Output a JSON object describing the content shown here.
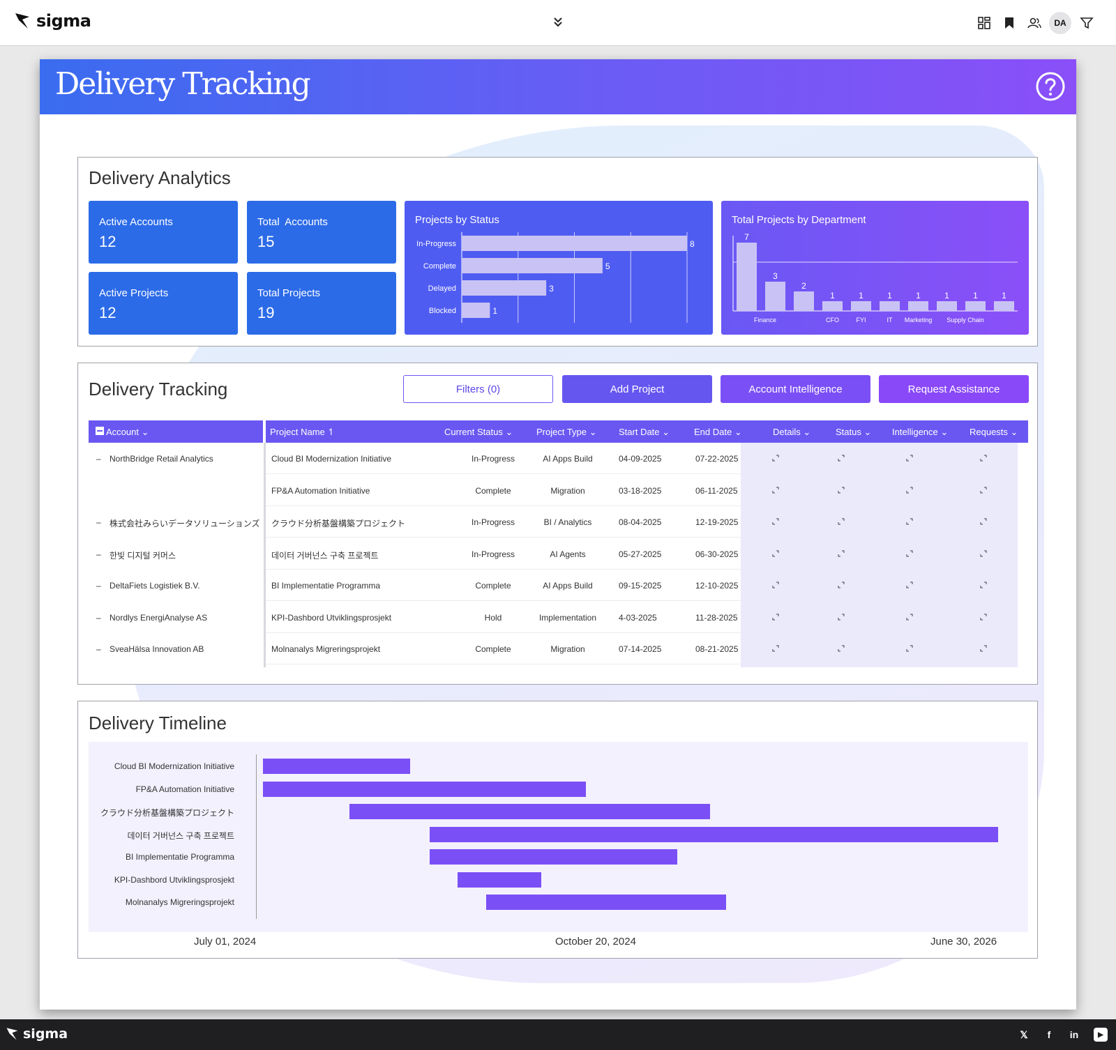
{
  "app": {
    "logo_text": "sigma",
    "avatar_initials": "DA"
  },
  "page": {
    "title": "Delivery Tracking"
  },
  "analytics": {
    "title": "Delivery Analytics",
    "kpis": [
      {
        "label": "Active Accounts",
        "value": "12"
      },
      {
        "label": "Total  Accounts",
        "value": "15"
      },
      {
        "label": "Active Projects",
        "value": "12"
      },
      {
        "label": "Total Projects",
        "value": "19"
      }
    ]
  },
  "chart_data": [
    {
      "type": "bar",
      "orientation": "horizontal",
      "title": "Projects by Status",
      "categories": [
        "In-Progress",
        "Complete",
        "Delayed",
        "Blocked"
      ],
      "values": [
        8,
        5,
        3,
        1
      ],
      "xlim": [
        0,
        8
      ],
      "grid": true
    },
    {
      "type": "bar",
      "title": "Total Projects by Department",
      "categories": [
        "Finance",
        "",
        "",
        "CFO",
        "FYI",
        "IT",
        "Marketing",
        "",
        "Supply Chain",
        ""
      ],
      "values": [
        7,
        3,
        2,
        1,
        1,
        1,
        1,
        1,
        1,
        1
      ],
      "ylim": [
        0,
        7
      ]
    }
  ],
  "tracking": {
    "title": "Delivery Tracking",
    "buttons": {
      "filters": "Filters (0)",
      "add_project": "Add Project",
      "account_intelligence": "Account Intelligence",
      "request_assistance": "Request Assistance"
    },
    "columns": {
      "account": "Account",
      "project_name": "Project Name",
      "current_status": "Current Status",
      "project_type": "Project Type",
      "start_date": "Start Date",
      "end_date": "End Date",
      "details": "Details",
      "status": "Status",
      "intelligence": "Intelligence",
      "requests": "Requests"
    },
    "rows": [
      {
        "account": "NorthBridge Retail Analytics",
        "project": "Cloud BI Modernization Initiative",
        "status": "In-Progress",
        "type": "AI Apps Build",
        "start": "04-09-2025",
        "end": "07-22-2025"
      },
      {
        "account": "",
        "project": "FP&A Automation Initiative",
        "status": "Complete",
        "type": "Migration",
        "start": "03-18-2025",
        "end": "06-11-2025"
      },
      {
        "account": "株式会社みらいデータソリューションズ",
        "project": "クラウド分析基盤構築プロジェクト",
        "status": "In-Progress",
        "type": "BI / Analytics",
        "start": "08-04-2025",
        "end": "12-19-2025"
      },
      {
        "account": "한빛 디지털 커머스",
        "project": "데이터 거버넌스 구축 프로젝트",
        "status": "In-Progress",
        "type": "AI Agents",
        "start": "05-27-2025",
        "end": "06-30-2025"
      },
      {
        "account": "DeltaFiets Logistiek B.V.",
        "project": "BI Implementatie Programma",
        "status": "Complete",
        "type": "AI Apps Build",
        "start": "09-15-2025",
        "end": "12-10-2025"
      },
      {
        "account": "Nordlys EnergiAnalyse AS",
        "project": "KPI-Dashbord Utviklingsprosjekt",
        "status": "Hold",
        "type": "Implementation",
        "start": "4-03-2025",
        "end": "11-28-2025"
      },
      {
        "account": "SveaHälsa Innovation AB",
        "project": "Molnanalys Migreringsprojekt",
        "status": "Complete",
        "type": "Migration",
        "start": "07-14-2025",
        "end": "08-21-2025"
      }
    ]
  },
  "timeline": {
    "title": "Delivery Timeline",
    "axis_dates": [
      "July 01, 2024",
      "October 20, 2024",
      "June 30, 2026"
    ],
    "tasks": [
      {
        "label": "Cloud BI Modernization Initiative",
        "start_frac": 0.0,
        "end_frac": 0.2
      },
      {
        "label": "FP&A Automation Initiative",
        "start_frac": 0.0,
        "end_frac": 0.439
      },
      {
        "label": "クラウド分析基盤構築プロジェクト",
        "start_frac": 0.118,
        "end_frac": 0.608
      },
      {
        "label": "데이터 거버넌스 구축 프로젝트",
        "start_frac": 0.227,
        "end_frac": 1.0
      },
      {
        "label": "BI Implementatie Programma",
        "start_frac": 0.227,
        "end_frac": 0.564
      },
      {
        "label": "KPI-Dashbord Utviklingsprosjekt",
        "start_frac": 0.265,
        "end_frac": 0.379
      },
      {
        "label": "Molnanalys Migreringsprojekt",
        "start_frac": 0.304,
        "end_frac": 0.63
      }
    ]
  },
  "colors": {
    "accent": "#6a57f2",
    "kpi_blue": "#2c6be8",
    "bar_purple": "#7b4ff6",
    "bar_light": "#c9c3f5"
  }
}
